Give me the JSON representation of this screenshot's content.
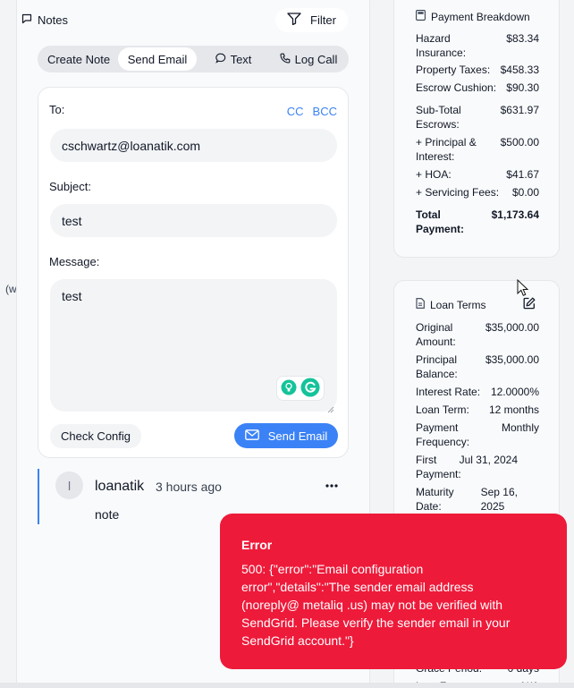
{
  "page_clip_text": "(w",
  "notes": {
    "header_label": "Notes",
    "filter_label": "Filter",
    "tabs": [
      {
        "label": "Create Note",
        "active": false
      },
      {
        "label": "Send Email",
        "active": true
      },
      {
        "label": "Text",
        "active": false
      },
      {
        "label": "Log Call",
        "active": false
      }
    ],
    "email_form": {
      "to_label": "To:",
      "cc_label": "CC",
      "bcc_label": "BCC",
      "to_value": "cschwartz@loanatik.com",
      "subject_label": "Subject:",
      "subject_value": "test",
      "message_label": "Message:",
      "message_value": "test",
      "check_config_label": "Check Config",
      "send_label": "Send Email"
    },
    "note": {
      "avatar_initial": "l",
      "author": "loanatik",
      "time": "3 hours ago",
      "text": "note"
    }
  },
  "payment_breakdown": {
    "title": "Payment Breakdown",
    "rows": [
      {
        "label": "Hazard\nInsurance:",
        "value": "$83.34"
      },
      {
        "label": "Property Taxes:",
        "value": "$458.33"
      },
      {
        "label": "Escrow Cushion:",
        "value": "$90.30"
      },
      {
        "label": "Sub-Total\nEscrows:",
        "value": "$631.97"
      },
      {
        "label": "+ Principal &\nInterest:",
        "value": "$500.00"
      },
      {
        "label": "+ HOA:",
        "value": "$41.67"
      },
      {
        "label": "+ Servicing Fees:",
        "value": "$0.00"
      },
      {
        "label": "Total\nPayment:",
        "value": "$1,173.64"
      }
    ]
  },
  "loan_terms": {
    "title": "Loan Terms",
    "rows": [
      {
        "label": "Original\nAmount:",
        "value": "$35,000.00"
      },
      {
        "label": "Principal\nBalance:",
        "value": "$35,000.00"
      },
      {
        "label": "Interest Rate:",
        "value": "12.0000%"
      },
      {
        "label": "Loan Term:",
        "value": "12 months"
      },
      {
        "label": "Payment\nFrequency:",
        "value": "Monthly"
      },
      {
        "label": "First\nPayment:",
        "value": "Jul 31,\n2024"
      },
      {
        "label": "Maturity\nDate:",
        "value": "Sep 16,\n2025"
      },
      {
        "label": "Grace Period:",
        "value": "0 days"
      },
      {
        "label": "Late Fee:",
        "value": "N/A"
      }
    ]
  },
  "toast": {
    "title": "Error",
    "message": "500: {\"error\":\"Email configuration\nerror\",\"details\":\"The sender email address\n(noreply@ metaliq .us) may not be verified with\nSendGrid. Please verify the sender email in your\nSendGrid account.\"}"
  },
  "colors": {
    "accent": "#3b82f6",
    "error": "#ee1a3a",
    "grammarly": "#15c39a"
  }
}
